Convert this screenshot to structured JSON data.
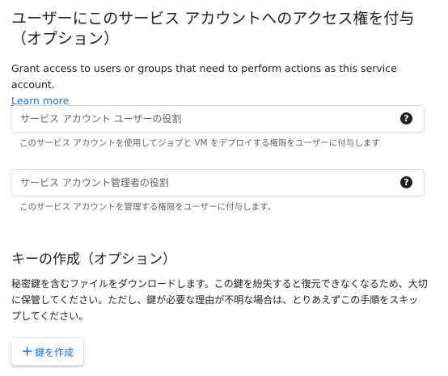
{
  "access_section": {
    "title": "ユーザーにこのサービス アカウントへのアクセス権を付与（オプション）",
    "description": "Grant access to users or groups that need to perform actions as this service account.",
    "learn_more": "Learn more"
  },
  "fields": {
    "user_role": {
      "placeholder": "サービス アカウント ユーザーの役割",
      "value": "",
      "hint": "このサービス アカウントを使用してジョブと VM をデプロイする権限をユーザーに付与します"
    },
    "admin_role": {
      "placeholder": "サービス アカウント管理者の役割",
      "value": "",
      "hint": "このサービス アカウントを管理する権限をユーザーに付与します。"
    }
  },
  "key_section": {
    "title": "キーの作成（オプション）",
    "description": "秘密鍵を含むファイルをダウンロードします。この鍵を紛失すると復元できなくなるため、大切に保管してください。ただし、鍵が必要な理由が不明な場合は、とりあえずこの手順をスキップしてください。",
    "create_button_label": "鍵を作成"
  },
  "icons": {
    "help": "help-icon",
    "plus": "plus-icon"
  },
  "colors": {
    "accent": "#1a73e8",
    "text": "#202124",
    "secondary_text": "#5f6368",
    "border": "#dadce0"
  }
}
